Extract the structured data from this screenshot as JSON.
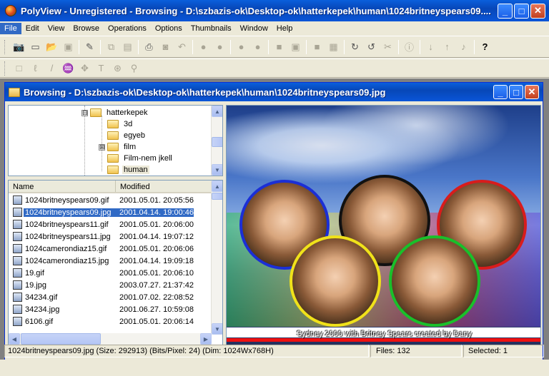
{
  "window": {
    "title": "PolyView - Unregistered - Browsing - D:\\szbazis-ok\\Desktop-ok\\hatterkepek\\human\\1024britneyspears09....",
    "minimize": "_",
    "maximize": "□",
    "close": "✕"
  },
  "menu": [
    "File",
    "Edit",
    "View",
    "Browse",
    "Operations",
    "Options",
    "Thumbnails",
    "Window",
    "Help"
  ],
  "toolbar1": {
    "icons": [
      "camera-icon",
      "new-icon",
      "open-folder-icon",
      "save-icon",
      "edit-icon",
      "copy-icon",
      "paste-icon",
      "print-icon",
      "scan-icon",
      "undo-icon",
      "dot-icon",
      "dot-icon",
      "dot-icon",
      "dot-icon",
      "frame-icon",
      "frame-icon",
      "frame-icon",
      "frame-icon",
      "rotate-cw-icon",
      "rotate-ccw-icon",
      "crop-icon",
      "info-icon",
      "down-arrow-icon",
      "up-arrow-icon",
      "music-icon",
      "help-icon"
    ]
  },
  "toolbar2": {
    "icons": [
      "select-rect-icon",
      "lasso-icon",
      "line-icon",
      "paint-icon",
      "move-icon",
      "text-icon",
      "stamp-icon",
      "zoom-icon"
    ]
  },
  "child_window": {
    "title": "Browsing - D:\\szbazis-ok\\Desktop-ok\\hatterkepek\\human\\1024britneyspears09.jpg"
  },
  "tree": {
    "items": [
      {
        "label": "hatterkepek",
        "expander": "⊟"
      },
      {
        "label": "3d"
      },
      {
        "label": "egyeb"
      },
      {
        "label": "film",
        "expander": "⊞"
      },
      {
        "label": "Film-nem jkell"
      },
      {
        "label": "human"
      }
    ]
  },
  "file_list": {
    "columns": [
      "Name",
      "Modified"
    ],
    "rows": [
      {
        "name": "1024britneyspears09.gif",
        "modified": "2001.05.01. 20:05:56"
      },
      {
        "name": "1024britneyspears09.jpg",
        "modified": "2001.04.14. 19:00:46",
        "selected": true
      },
      {
        "name": "1024britneyspears11.gif",
        "modified": "2001.05.01. 20:06:00"
      },
      {
        "name": "1024britneyspears11.jpg",
        "modified": "2001.04.14. 19:07:12"
      },
      {
        "name": "1024camerondiaz15.gif",
        "modified": "2001.05.01. 20:06:06"
      },
      {
        "name": "1024camerondiaz15.jpg",
        "modified": "2001.04.14. 19:09:18"
      },
      {
        "name": "19.gif",
        "modified": "2001.05.01. 20:06:10"
      },
      {
        "name": "19.jpg",
        "modified": "2003.07.27. 21:37:42"
      },
      {
        "name": "34234.gif",
        "modified": "2001.07.02. 22:08:52"
      },
      {
        "name": "34234.jpg",
        "modified": "2001.06.27. 10:59:08"
      },
      {
        "name": "6106.gif",
        "modified": "2001.05.01. 20:06:14"
      }
    ]
  },
  "image": {
    "caption": "Sydney 2000 with Britney Spears created by Dany",
    "ring_colors": [
      "#1b2fd6",
      "#f0e21a",
      "#111111",
      "#19c02a",
      "#d81c1c"
    ]
  },
  "status": {
    "file_info": "1024britneyspears09.jpg (Size: 292913) (Bits/Pixel: 24) (Dim: 1024Wx768H)",
    "files": "Files: 132",
    "selected": "Selected: 1"
  }
}
